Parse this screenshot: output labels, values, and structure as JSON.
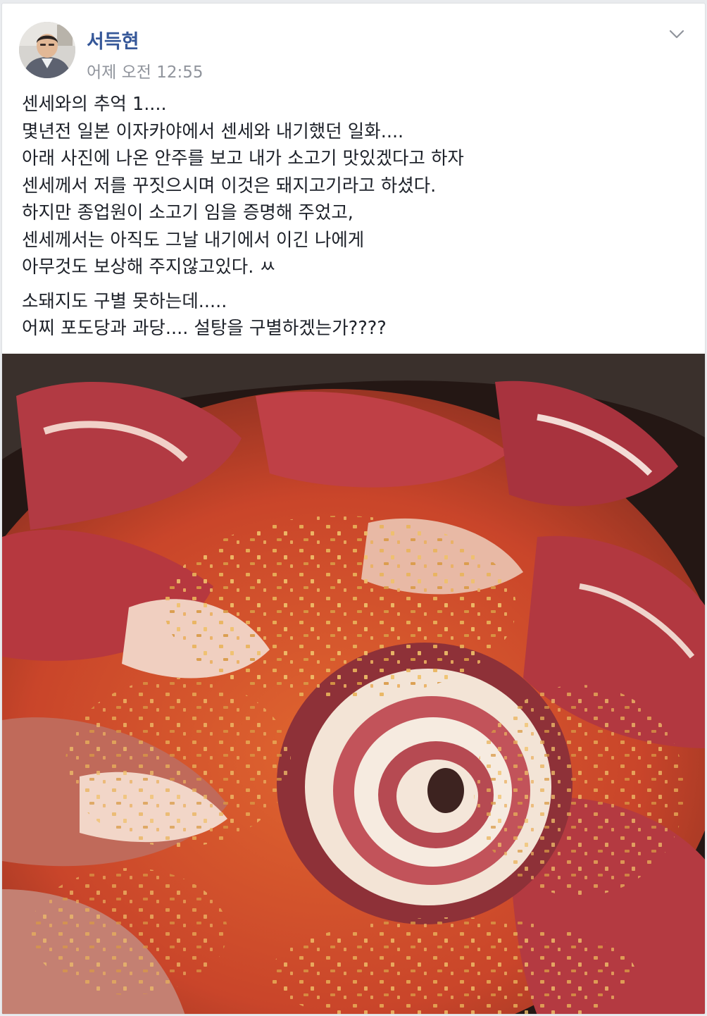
{
  "post": {
    "author": "서득현",
    "timestamp": "어제 오전 12:55",
    "paragraphs": [
      {
        "lines": [
          "센세와의 추억 1....",
          "몇년전 일본 이자카야에서 센세와 내기했던 일화....",
          "아래 사진에 나온 안주를 보고 내가 소고기 맛있겠다고 하자",
          "센세께서 저를 꾸짓으시며 이것은 돼지고기라고 하셨다.",
          "하지만 종업원이 소고기 임을 증명해 주었고,",
          "센세께서는 아직도 그날 내기에서 이긴 나에게",
          "아무것도 보상해 주지않고있다. ㅆ"
        ]
      },
      {
        "lines": [
          "소돼지도 구별 못하는데.....",
          "어찌 포도당과 과당.... 설탕을 구별하겠는가????"
        ]
      }
    ],
    "icons": {
      "avatar": "profile-photo",
      "options": "chevron-down-icon"
    },
    "photo": "food-photo"
  },
  "colors": {
    "author_link": "#365899",
    "timestamp": "#90949c",
    "text": "#1d2129",
    "page_bg": "#e9ebee"
  }
}
